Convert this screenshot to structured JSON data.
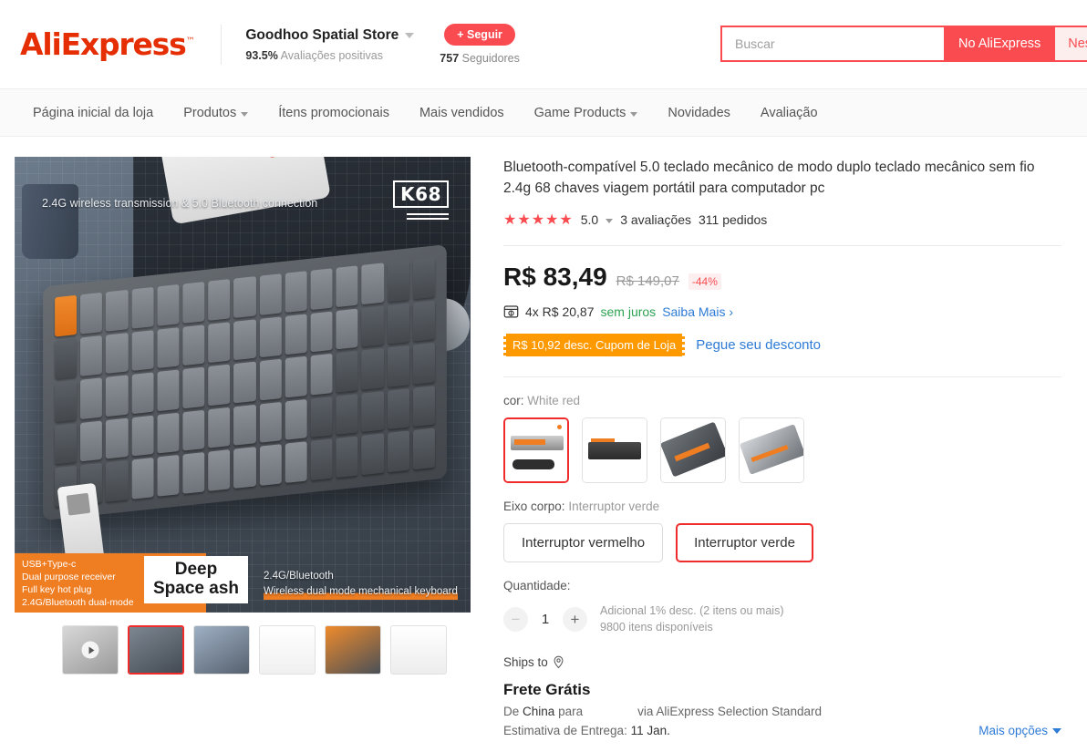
{
  "header": {
    "logo": "AliExpress",
    "logo_tm": "™",
    "store_name": "Goodhoo Spatial Store",
    "rating_pct": "93.5%",
    "rating_text": "Avaliações positivas",
    "follow_label": "+ Seguir",
    "followers_count": "757",
    "followers_label": "Seguidores",
    "search_placeholder": "Buscar",
    "search_value": "",
    "btn_all": "No AliExpress",
    "btn_store": "Nesta loja"
  },
  "nav": {
    "items": [
      {
        "label": "Página inicial da loja",
        "caret": false
      },
      {
        "label": "Produtos",
        "caret": true
      },
      {
        "label": "Ítens promocionais",
        "caret": false
      },
      {
        "label": "Mais vendidos",
        "caret": false
      },
      {
        "label": "Game Products",
        "caret": true
      },
      {
        "label": "Novidades",
        "caret": false
      },
      {
        "label": "Avaliação",
        "caret": false
      }
    ]
  },
  "gallery": {
    "caption_top": "2.4G wireless transmission & 5.0 Bluetooth connection",
    "badge": "K68",
    "orange_box": "USB+Type-c\nDual purpose receiver\nFull key hot plug\n2.4G/Bluetooth dual-mode",
    "white_box": "Deep\nSpace ash",
    "caption_br_line1": "2.4G/Bluetooth",
    "caption_br_line2": "Wireless dual mode mechanical keyboard",
    "thumbs": [
      {
        "name": "thumbnail-video",
        "has_video": true,
        "selected": false
      },
      {
        "name": "thumbnail-2",
        "has_video": false,
        "selected": true
      },
      {
        "name": "thumbnail-3",
        "has_video": false,
        "selected": false
      },
      {
        "name": "thumbnail-4",
        "has_video": false,
        "selected": false
      },
      {
        "name": "thumbnail-5",
        "has_video": false,
        "selected": false
      },
      {
        "name": "thumbnail-6",
        "has_video": false,
        "selected": false
      }
    ]
  },
  "product": {
    "title": "Bluetooth-compatível 5.0 teclado mecânico de modo duplo teclado mecânico sem fio 2.4g 68 chaves viagem portátil para computador pc",
    "stars": "★★★★★",
    "rating_value": "5.0",
    "reviews": "3 avaliações",
    "orders": "311 pedidos",
    "price_now": "R$ 83,49",
    "price_old": "R$ 149,07",
    "discount": "-44%",
    "installment": "4x R$ 20,87",
    "installment_free": "sem juros",
    "installment_link": "Saiba Mais",
    "coupon_badge": "R$ 10,92 desc. Cupom de Loja",
    "coupon_link": "Pegue seu desconto",
    "color_label": "cor:",
    "color_value": "White red",
    "color_options": [
      {
        "name": "color-white-red",
        "selected": true
      },
      {
        "name": "color-black",
        "selected": false
      },
      {
        "name": "color-grey-orange",
        "selected": false
      },
      {
        "name": "color-deep-space-ash",
        "selected": false
      }
    ],
    "switch_label": "Eixo corpo:",
    "switch_value": "Interruptor verde",
    "switch_options": [
      {
        "label": "Interruptor vermelho",
        "selected": false
      },
      {
        "label": "Interruptor verde",
        "selected": true
      }
    ],
    "qty_label": "Quantidade:",
    "qty_value": "1",
    "qty_minus": "−",
    "qty_plus": "+",
    "qty_note1": "Adicional 1% desc. (2 itens ou mais)",
    "qty_note2": "9800 itens disponíveis"
  },
  "shipping": {
    "ships_to_label": "Ships to",
    "free_title": "Frete Grátis",
    "from_prefix": "De",
    "from_country": "China",
    "from_suffix": "para",
    "via": "via AliExpress Selection Standard",
    "eta_label": "Estimativa de Entrega:",
    "eta_value": "11 Jan.",
    "more_options": "Mais opções"
  }
}
